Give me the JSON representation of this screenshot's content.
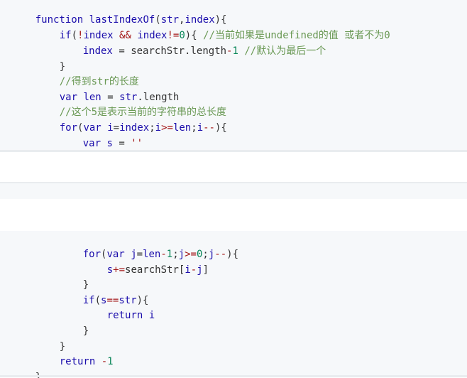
{
  "code": {
    "top": [
      "function lastIndexOf(str,index){",
      "    if(!index && index!=0){ //当前如果是undefined的值 或者不为0",
      "        index = searchStr.length-1 //默认为最后一个",
      "    }",
      "    //得到str的长度",
      "    var len = str.length",
      "    //这个5是表示当前的字符串的总长度",
      "    for(var i=index;i>=len;i--){",
      "        var s = ''"
    ],
    "bottom": [
      "        for(var j=len-1;j>=0;j--){",
      "            s+=searchStr[i-j]",
      "        }",
      "        if(s==str){",
      "            return i",
      "        }",
      "    }",
      "    return -1",
      "}"
    ]
  }
}
